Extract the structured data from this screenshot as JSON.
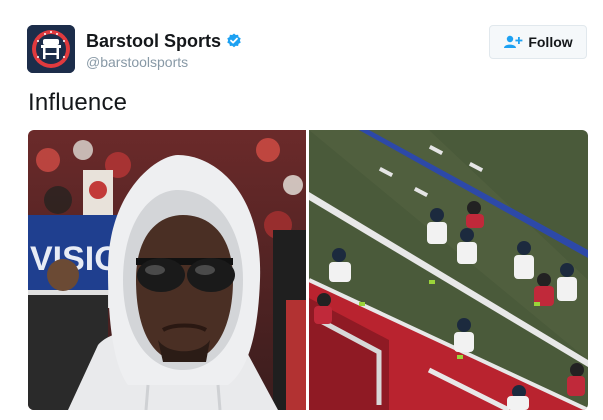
{
  "account": {
    "display_name": "Barstool Sports",
    "handle": "@barstoolsports",
    "verified": true,
    "avatar_icon": "barstool-logo-icon"
  },
  "follow_button": {
    "label": "Follow",
    "icon": "add-user-icon"
  },
  "tweet": {
    "text": "Influence"
  },
  "media": {
    "photos": [
      {
        "name": "photo-man-in-hoodie",
        "description_icon": "photo"
      },
      {
        "name": "photo-football-field",
        "description_icon": "photo"
      }
    ]
  },
  "colors": {
    "brand_blue": "#1da1f2",
    "verified_blue": "#1da1f2",
    "avatar_bg": "#1c2d4a",
    "avatar_red": "#e03a3e"
  }
}
